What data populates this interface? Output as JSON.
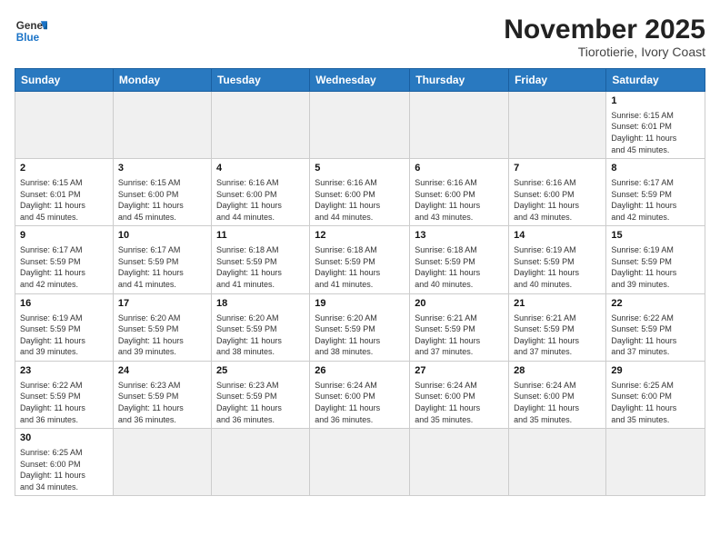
{
  "logo": {
    "line1": "General",
    "line2": "Blue"
  },
  "title": "November 2025",
  "subtitle": "Tiorotierie, Ivory Coast",
  "weekdays": [
    "Sunday",
    "Monday",
    "Tuesday",
    "Wednesday",
    "Thursday",
    "Friday",
    "Saturday"
  ],
  "weeks": [
    [
      {
        "day": "",
        "info": ""
      },
      {
        "day": "",
        "info": ""
      },
      {
        "day": "",
        "info": ""
      },
      {
        "day": "",
        "info": ""
      },
      {
        "day": "",
        "info": ""
      },
      {
        "day": "",
        "info": ""
      },
      {
        "day": "1",
        "info": "Sunrise: 6:15 AM\nSunset: 6:01 PM\nDaylight: 11 hours\nand 45 minutes."
      }
    ],
    [
      {
        "day": "2",
        "info": "Sunrise: 6:15 AM\nSunset: 6:01 PM\nDaylight: 11 hours\nand 45 minutes."
      },
      {
        "day": "3",
        "info": "Sunrise: 6:15 AM\nSunset: 6:00 PM\nDaylight: 11 hours\nand 45 minutes."
      },
      {
        "day": "4",
        "info": "Sunrise: 6:16 AM\nSunset: 6:00 PM\nDaylight: 11 hours\nand 44 minutes."
      },
      {
        "day": "5",
        "info": "Sunrise: 6:16 AM\nSunset: 6:00 PM\nDaylight: 11 hours\nand 44 minutes."
      },
      {
        "day": "6",
        "info": "Sunrise: 6:16 AM\nSunset: 6:00 PM\nDaylight: 11 hours\nand 43 minutes."
      },
      {
        "day": "7",
        "info": "Sunrise: 6:16 AM\nSunset: 6:00 PM\nDaylight: 11 hours\nand 43 minutes."
      },
      {
        "day": "8",
        "info": "Sunrise: 6:17 AM\nSunset: 5:59 PM\nDaylight: 11 hours\nand 42 minutes."
      }
    ],
    [
      {
        "day": "9",
        "info": "Sunrise: 6:17 AM\nSunset: 5:59 PM\nDaylight: 11 hours\nand 42 minutes."
      },
      {
        "day": "10",
        "info": "Sunrise: 6:17 AM\nSunset: 5:59 PM\nDaylight: 11 hours\nand 41 minutes."
      },
      {
        "day": "11",
        "info": "Sunrise: 6:18 AM\nSunset: 5:59 PM\nDaylight: 11 hours\nand 41 minutes."
      },
      {
        "day": "12",
        "info": "Sunrise: 6:18 AM\nSunset: 5:59 PM\nDaylight: 11 hours\nand 41 minutes."
      },
      {
        "day": "13",
        "info": "Sunrise: 6:18 AM\nSunset: 5:59 PM\nDaylight: 11 hours\nand 40 minutes."
      },
      {
        "day": "14",
        "info": "Sunrise: 6:19 AM\nSunset: 5:59 PM\nDaylight: 11 hours\nand 40 minutes."
      },
      {
        "day": "15",
        "info": "Sunrise: 6:19 AM\nSunset: 5:59 PM\nDaylight: 11 hours\nand 39 minutes."
      }
    ],
    [
      {
        "day": "16",
        "info": "Sunrise: 6:19 AM\nSunset: 5:59 PM\nDaylight: 11 hours\nand 39 minutes."
      },
      {
        "day": "17",
        "info": "Sunrise: 6:20 AM\nSunset: 5:59 PM\nDaylight: 11 hours\nand 39 minutes."
      },
      {
        "day": "18",
        "info": "Sunrise: 6:20 AM\nSunset: 5:59 PM\nDaylight: 11 hours\nand 38 minutes."
      },
      {
        "day": "19",
        "info": "Sunrise: 6:20 AM\nSunset: 5:59 PM\nDaylight: 11 hours\nand 38 minutes."
      },
      {
        "day": "20",
        "info": "Sunrise: 6:21 AM\nSunset: 5:59 PM\nDaylight: 11 hours\nand 37 minutes."
      },
      {
        "day": "21",
        "info": "Sunrise: 6:21 AM\nSunset: 5:59 PM\nDaylight: 11 hours\nand 37 minutes."
      },
      {
        "day": "22",
        "info": "Sunrise: 6:22 AM\nSunset: 5:59 PM\nDaylight: 11 hours\nand 37 minutes."
      }
    ],
    [
      {
        "day": "23",
        "info": "Sunrise: 6:22 AM\nSunset: 5:59 PM\nDaylight: 11 hours\nand 36 minutes."
      },
      {
        "day": "24",
        "info": "Sunrise: 6:23 AM\nSunset: 5:59 PM\nDaylight: 11 hours\nand 36 minutes."
      },
      {
        "day": "25",
        "info": "Sunrise: 6:23 AM\nSunset: 5:59 PM\nDaylight: 11 hours\nand 36 minutes."
      },
      {
        "day": "26",
        "info": "Sunrise: 6:24 AM\nSunset: 6:00 PM\nDaylight: 11 hours\nand 36 minutes."
      },
      {
        "day": "27",
        "info": "Sunrise: 6:24 AM\nSunset: 6:00 PM\nDaylight: 11 hours\nand 35 minutes."
      },
      {
        "day": "28",
        "info": "Sunrise: 6:24 AM\nSunset: 6:00 PM\nDaylight: 11 hours\nand 35 minutes."
      },
      {
        "day": "29",
        "info": "Sunrise: 6:25 AM\nSunset: 6:00 PM\nDaylight: 11 hours\nand 35 minutes."
      }
    ],
    [
      {
        "day": "30",
        "info": "Sunrise: 6:25 AM\nSunset: 6:00 PM\nDaylight: 11 hours\nand 34 minutes."
      },
      {
        "day": "",
        "info": ""
      },
      {
        "day": "",
        "info": ""
      },
      {
        "day": "",
        "info": ""
      },
      {
        "day": "",
        "info": ""
      },
      {
        "day": "",
        "info": ""
      },
      {
        "day": "",
        "info": ""
      }
    ]
  ]
}
